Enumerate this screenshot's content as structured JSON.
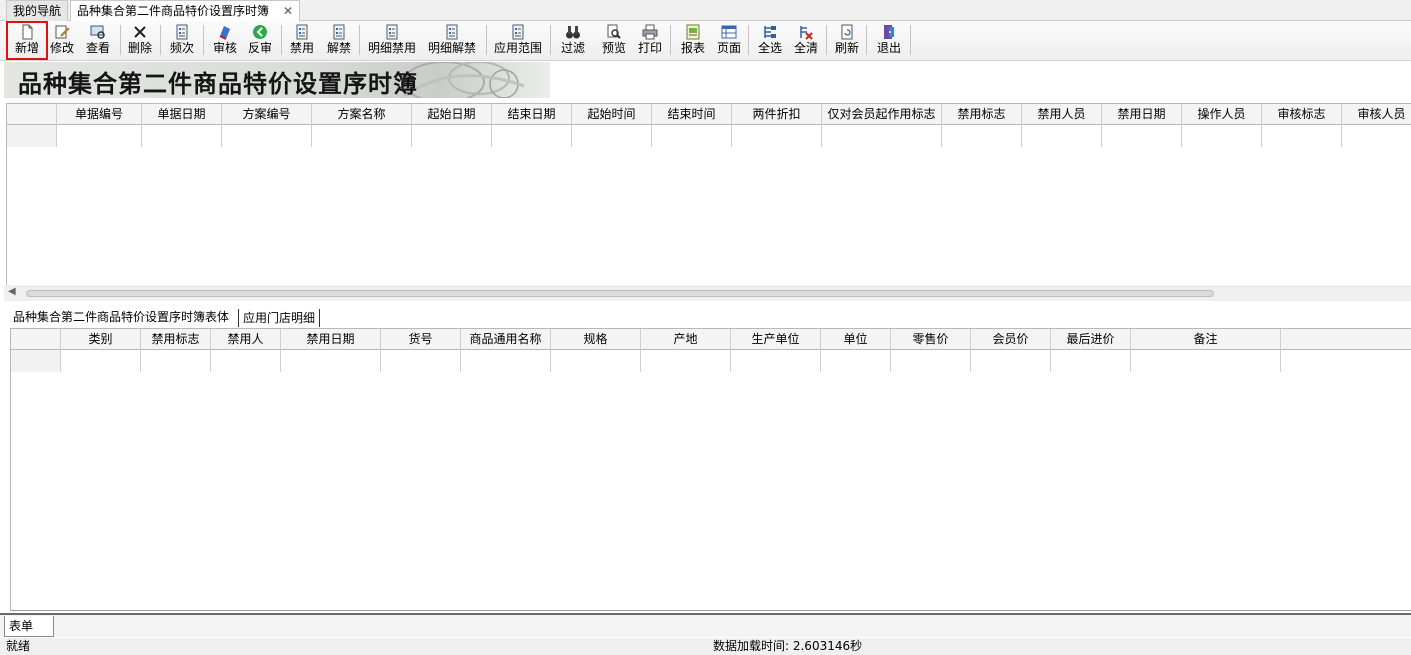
{
  "tabs": {
    "nav_label": "我的导航",
    "active_label": "品种集合第二件商品特价设置序时簿",
    "close_glyph": "✕"
  },
  "toolbar": [
    {
      "label": "新增",
      "icon": "new-doc-icon"
    },
    {
      "label": "修改",
      "icon": "edit-icon"
    },
    {
      "label": "查看",
      "icon": "view-icon"
    },
    {
      "label": "删除",
      "icon": "delete-icon"
    },
    {
      "label": "频次",
      "icon": "list-icon"
    },
    {
      "label": "审核",
      "icon": "audit-icon"
    },
    {
      "label": "反审",
      "icon": "unaudit-icon"
    },
    {
      "label": "禁用",
      "icon": "list-icon"
    },
    {
      "label": "解禁",
      "icon": "list-icon"
    },
    {
      "label": "明细禁用",
      "icon": "list-icon"
    },
    {
      "label": "明细解禁",
      "icon": "list-icon"
    },
    {
      "label": "应用范围",
      "icon": "list-icon"
    },
    {
      "label": "过滤",
      "icon": "binoculars-icon"
    },
    {
      "label": "预览",
      "icon": "preview-icon"
    },
    {
      "label": "打印",
      "icon": "printer-icon"
    },
    {
      "label": "报表",
      "icon": "report-icon"
    },
    {
      "label": "页面",
      "icon": "page-icon"
    },
    {
      "label": "全选",
      "icon": "select-all-icon"
    },
    {
      "label": "全清",
      "icon": "clear-all-icon"
    },
    {
      "label": "刷新",
      "icon": "refresh-icon"
    },
    {
      "label": "退出",
      "icon": "exit-icon"
    }
  ],
  "banner": {
    "title": "品种集合第二件商品特价设置序时簿"
  },
  "upper_grid": {
    "columns": [
      "单据编号",
      "单据日期",
      "方案编号",
      "方案名称",
      "起始日期",
      "结束日期",
      "起始时间",
      "结束时间",
      "两件折扣",
      "仅对会员起作用标志",
      "禁用标志",
      "禁用人员",
      "禁用日期",
      "操作人员",
      "审核标志",
      "审核人员"
    ]
  },
  "lower_tabs": {
    "active": "品种集合第二件商品特价设置序时簿表体",
    "second": "应用门店明细"
  },
  "lower_grid": {
    "columns": [
      "类别",
      "禁用标志",
      "禁用人",
      "禁用日期",
      "货号",
      "商品通用名称",
      "规格",
      "产地",
      "生产单位",
      "单位",
      "零售价",
      "会员价",
      "最后进价",
      "备注"
    ]
  },
  "bottom_tab": "表单",
  "status": {
    "ready": "就绪",
    "load_time": "数据加载时间: 2.603146秒"
  },
  "colors": {
    "selected_outline": "#e01010",
    "header_bg": "#f4f4f4"
  }
}
